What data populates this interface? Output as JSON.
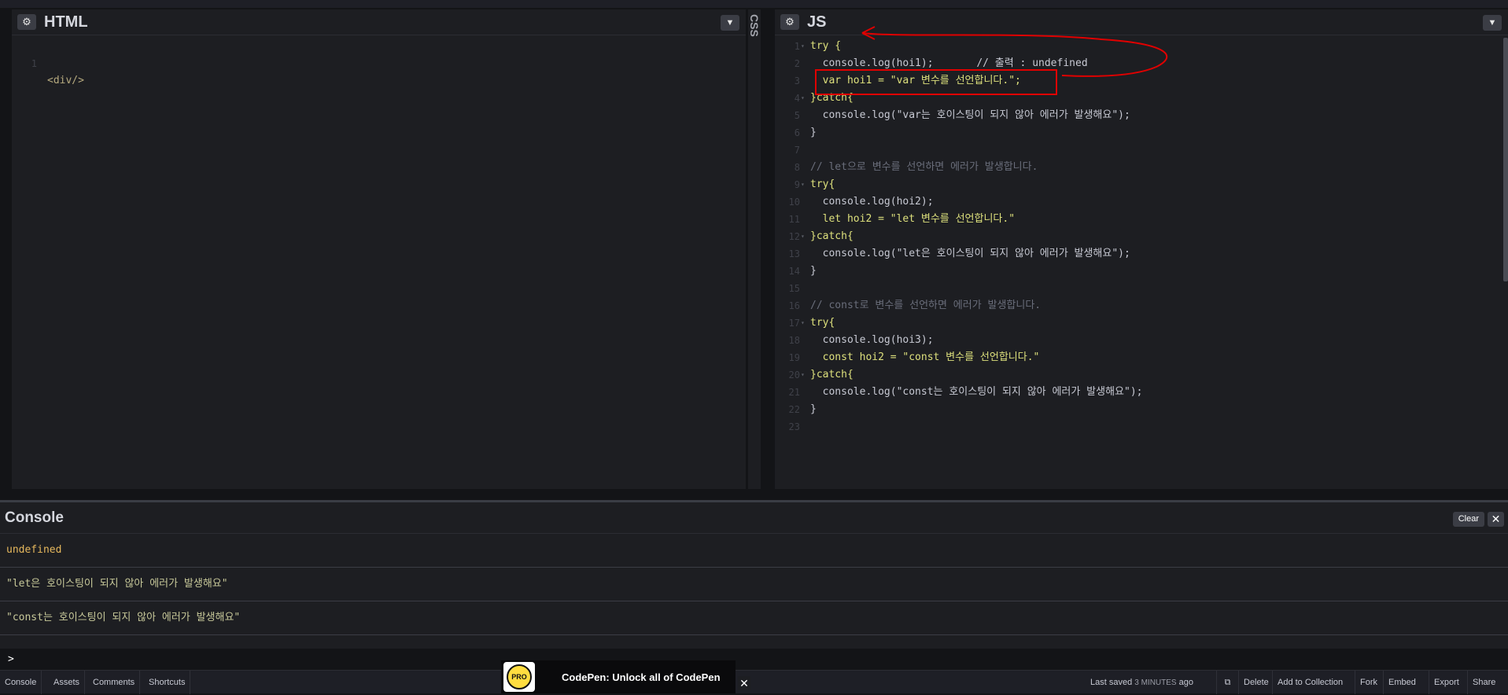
{
  "html_panel": {
    "title": "HTML",
    "lines": [
      {
        "num": "1",
        "code": "<div/>"
      }
    ]
  },
  "css_panel": {
    "title": "CSS"
  },
  "js_panel": {
    "title": "JS",
    "line_numbers": [
      "1",
      "2",
      "3",
      "4",
      "5",
      "6",
      "7",
      "8",
      "9",
      "10",
      "11",
      "12",
      "13",
      "14",
      "15",
      "16",
      "17",
      "18",
      "19",
      "20",
      "21",
      "22",
      "23"
    ],
    "lines": [
      "try {",
      "  console.log(hoi1);       // 출력 : undefined",
      "  var hoi1 = \"var 변수를 선언합니다.\";",
      "}catch{",
      "  console.log(\"var는 호이스팅이 되지 않아 에러가 발생해요\");",
      "}",
      "",
      "// let으로 변수를 선언하면 에러가 발생합니다.",
      "try{",
      "  console.log(hoi2);",
      "  let hoi2 = \"let 변수를 선언합니다.\"",
      "}catch{",
      "  console.log(\"let은 호이스팅이 되지 않아 에러가 발생해요\");",
      "}",
      "",
      "// const로 변수를 선언하면 에러가 발생합니다.",
      "try{",
      "  console.log(hoi3);",
      "  const hoi2 = \"const 변수를 선언합니다.\"",
      "}catch{",
      "  console.log(\"const는 호이스팅이 되지 않아 에러가 발생해요\");",
      "}",
      ""
    ]
  },
  "console": {
    "title": "Console",
    "clear_label": "Clear",
    "close_label": "✕",
    "entries": [
      "undefined",
      "\"let은 호이스팅이 되지 않아 에러가 발생해요\"",
      "\"const는 호이스팅이 되지 않아 에러가 발생해요\""
    ],
    "prompt": ">"
  },
  "bottom_bar": {
    "left_buttons": [
      "Console",
      "Assets",
      "Comments",
      "Shortcuts"
    ],
    "saved_label": "Last saved",
    "saved_time": "3 MINUTES",
    "saved_suffix": "ago",
    "right_buttons": [
      "Delete",
      "Add to Collection",
      "Fork",
      "Embed",
      "Export",
      "Share"
    ]
  },
  "promo": {
    "badge": "PRO",
    "text": "CodePen: Unlock all of CodePen",
    "close_label": "✕"
  },
  "icons": {
    "gear": "gear-icon",
    "chevron": "chevron-down-icon",
    "external": "external-link-icon"
  },
  "annotation_color": "#e00000"
}
